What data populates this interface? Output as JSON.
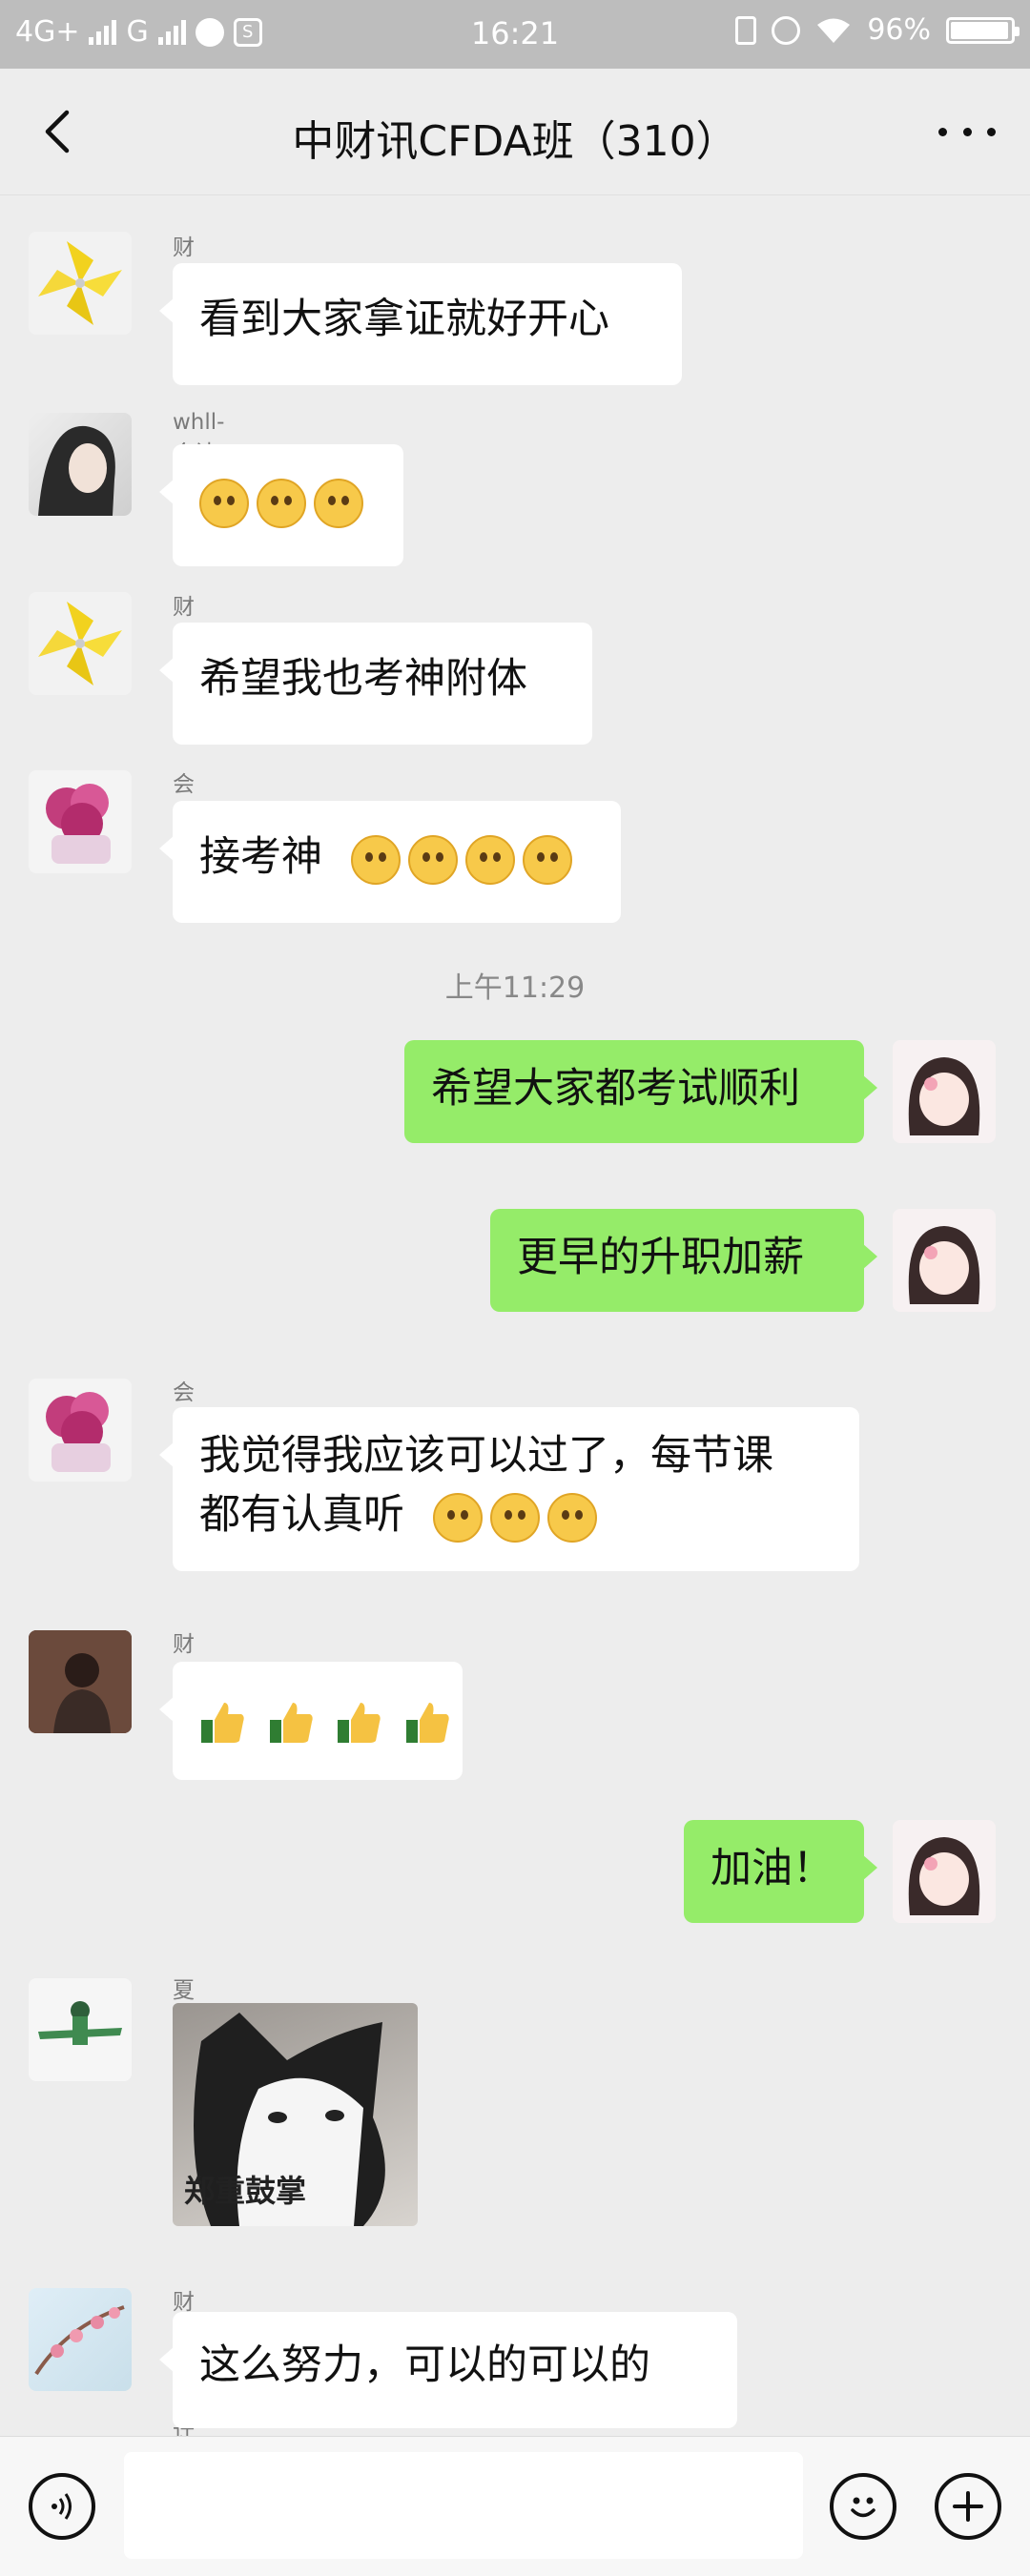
{
  "status_bar": {
    "network_left": "4G+",
    "network_right": "G",
    "time": "16:21",
    "battery_percent": "96%",
    "battery_level": 0.96
  },
  "header": {
    "title": "中财讯CFDA班（310）"
  },
  "messages": [
    {
      "sender": "财务小曲",
      "text": "看到大家拿证就好开心",
      "direction": "in"
    },
    {
      "sender": "whll-会计",
      "text": "",
      "emoji": [
        "hushed-face",
        "hushed-face",
        "hushed-face"
      ],
      "direction": "in"
    },
    {
      "sender": "财务小曲",
      "text": "希望我也考神附体",
      "direction": "in"
    },
    {
      "sender": "会计李姐",
      "text": "接考神",
      "emoji": [
        "smirk-face",
        "smirk-face",
        "smirk-face",
        "smirk-face"
      ],
      "direction": "in"
    },
    {
      "timestamp": "上午11:29"
    },
    {
      "text": "希望大家都考试顺利",
      "direction": "out"
    },
    {
      "text": "更早的升职加薪",
      "direction": "out"
    },
    {
      "sender": "会计李姐",
      "line1": "我觉得我应该可以过了，每节课",
      "line2": "都有认真听",
      "emoji": [
        "smirk-face",
        "smirk-face",
        "smirk-face"
      ],
      "direction": "in"
    },
    {
      "sender": "财务-C",
      "emoji": [
        "thumbs-up",
        "thumbs-up",
        "thumbs-up",
        "thumbs-up"
      ],
      "direction": "in"
    },
    {
      "text": "加油！",
      "direction": "out"
    },
    {
      "sender": "夏会计",
      "image_caption": "郑重鼓掌",
      "direction": "in"
    },
    {
      "sender": "财务-肖会计",
      "text": "这么努力，可以的可以的",
      "direction": "in"
    }
  ],
  "input": {
    "placeholder": ""
  },
  "colors": {
    "outgoing_bubble": "#95ec69",
    "incoming_bubble": "#ffffff",
    "background": "#ededed"
  }
}
